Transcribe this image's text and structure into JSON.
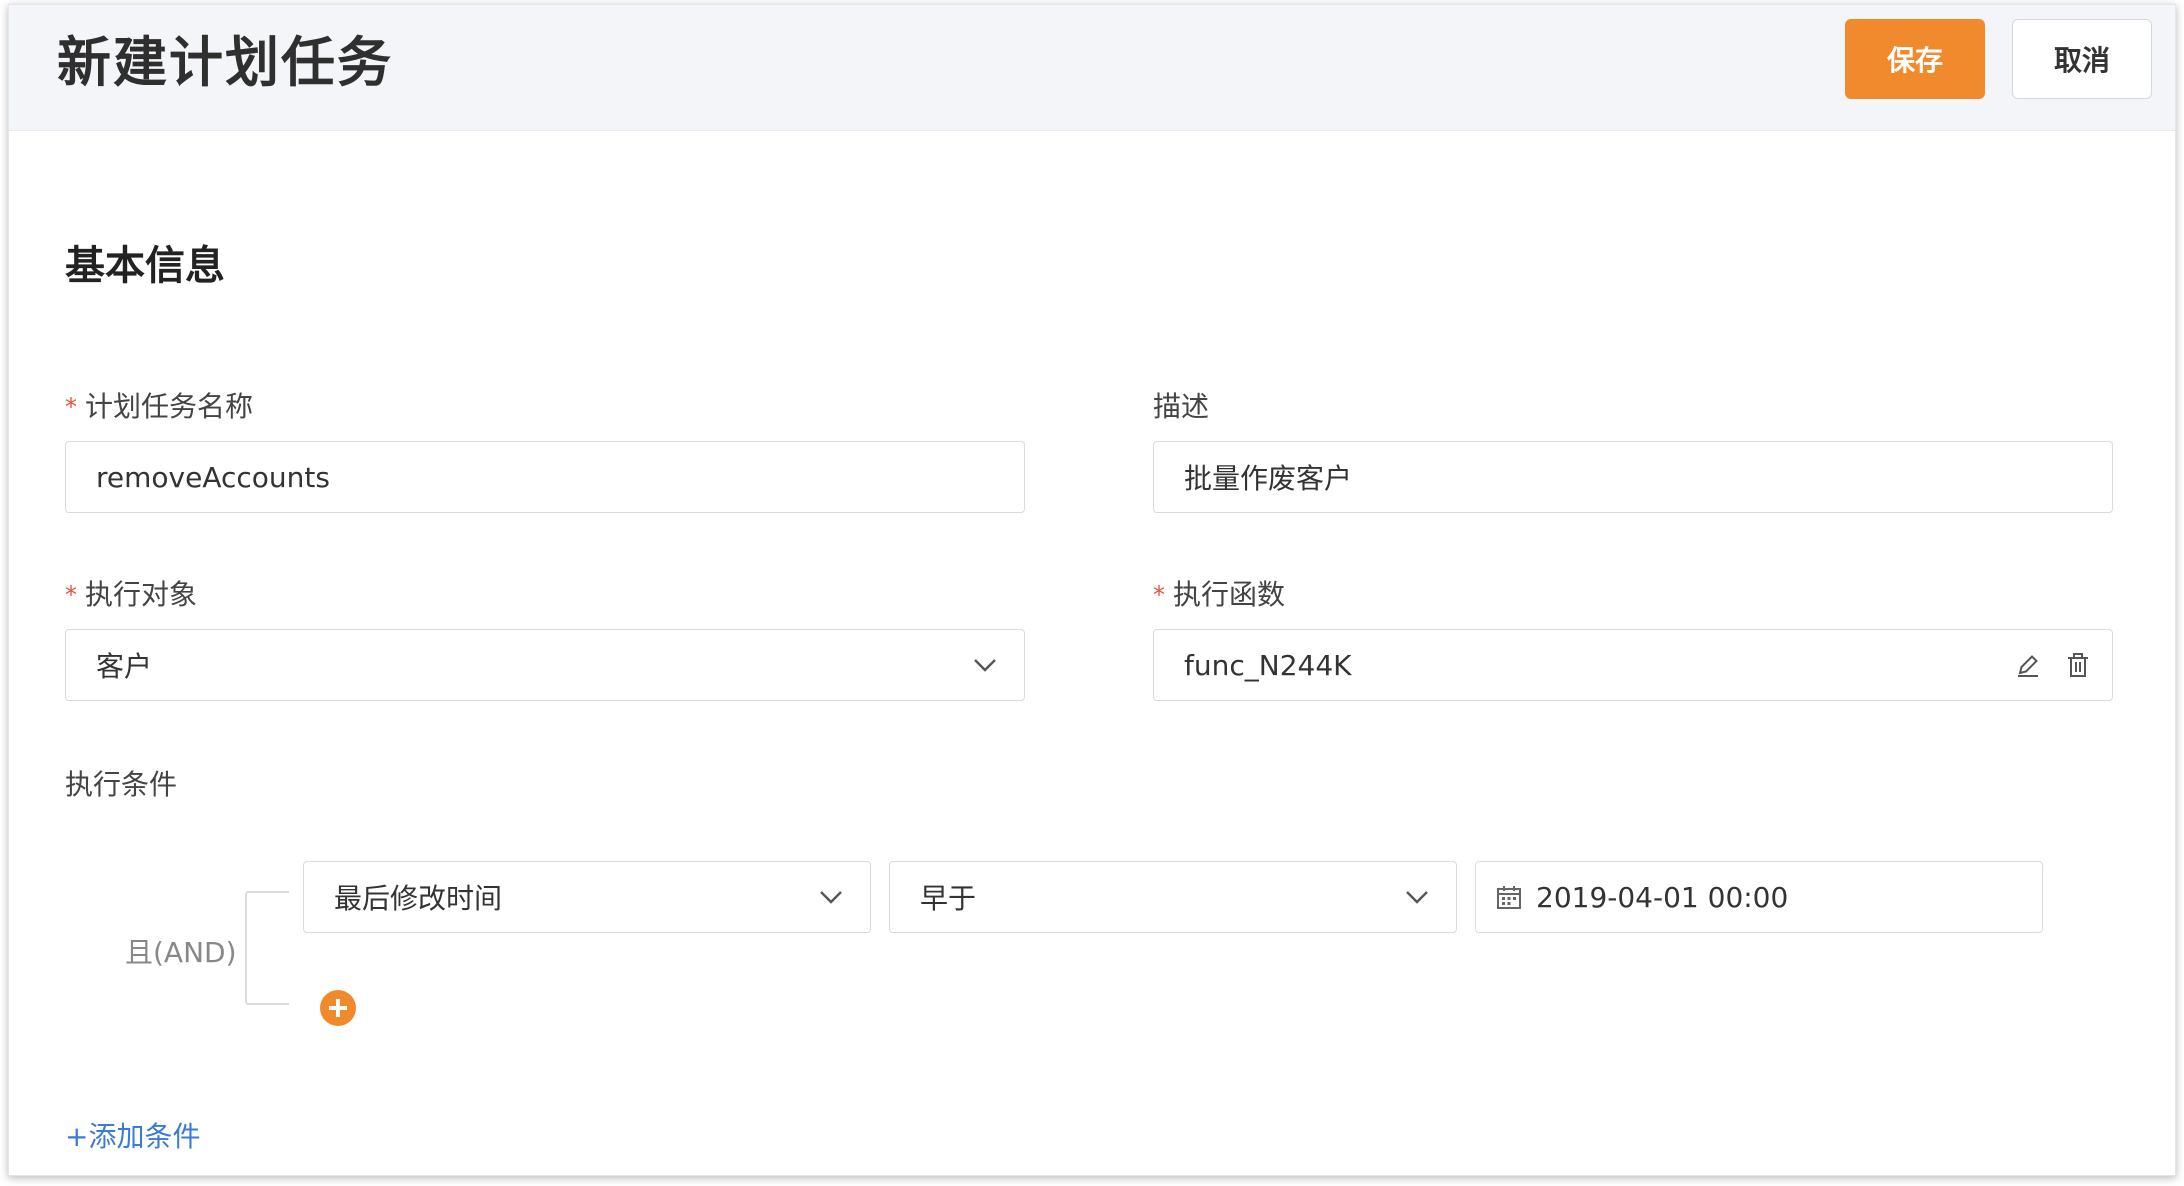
{
  "header": {
    "title": "新建计划任务",
    "save_label": "保存",
    "cancel_label": "取消"
  },
  "section": {
    "title": "基本信息"
  },
  "form": {
    "task_name": {
      "label": "计划任务名称",
      "required": true,
      "value": "removeAccounts"
    },
    "description": {
      "label": "描述",
      "required": false,
      "value": "批量作废客户"
    },
    "target_object": {
      "label": "执行对象",
      "required": true,
      "value": "客户"
    },
    "function": {
      "label": "执行函数",
      "required": true,
      "value": "func_N244K"
    }
  },
  "conditions": {
    "label": "执行条件",
    "logic": "且(AND)",
    "rows": [
      {
        "field": "最后修改时间",
        "operator": "早于",
        "value": "2019-04-01 00:00"
      }
    ],
    "add_label": "+添加条件"
  },
  "icons": {
    "required_mark": "*",
    "chevron": "chevron-down-icon",
    "edit": "pencil-icon",
    "delete": "trash-icon",
    "calendar": "calendar-icon",
    "add": "plus-circle-icon"
  },
  "colors": {
    "accent": "#f08a2c",
    "link": "#3a7bd5",
    "required": "#e5533d"
  }
}
